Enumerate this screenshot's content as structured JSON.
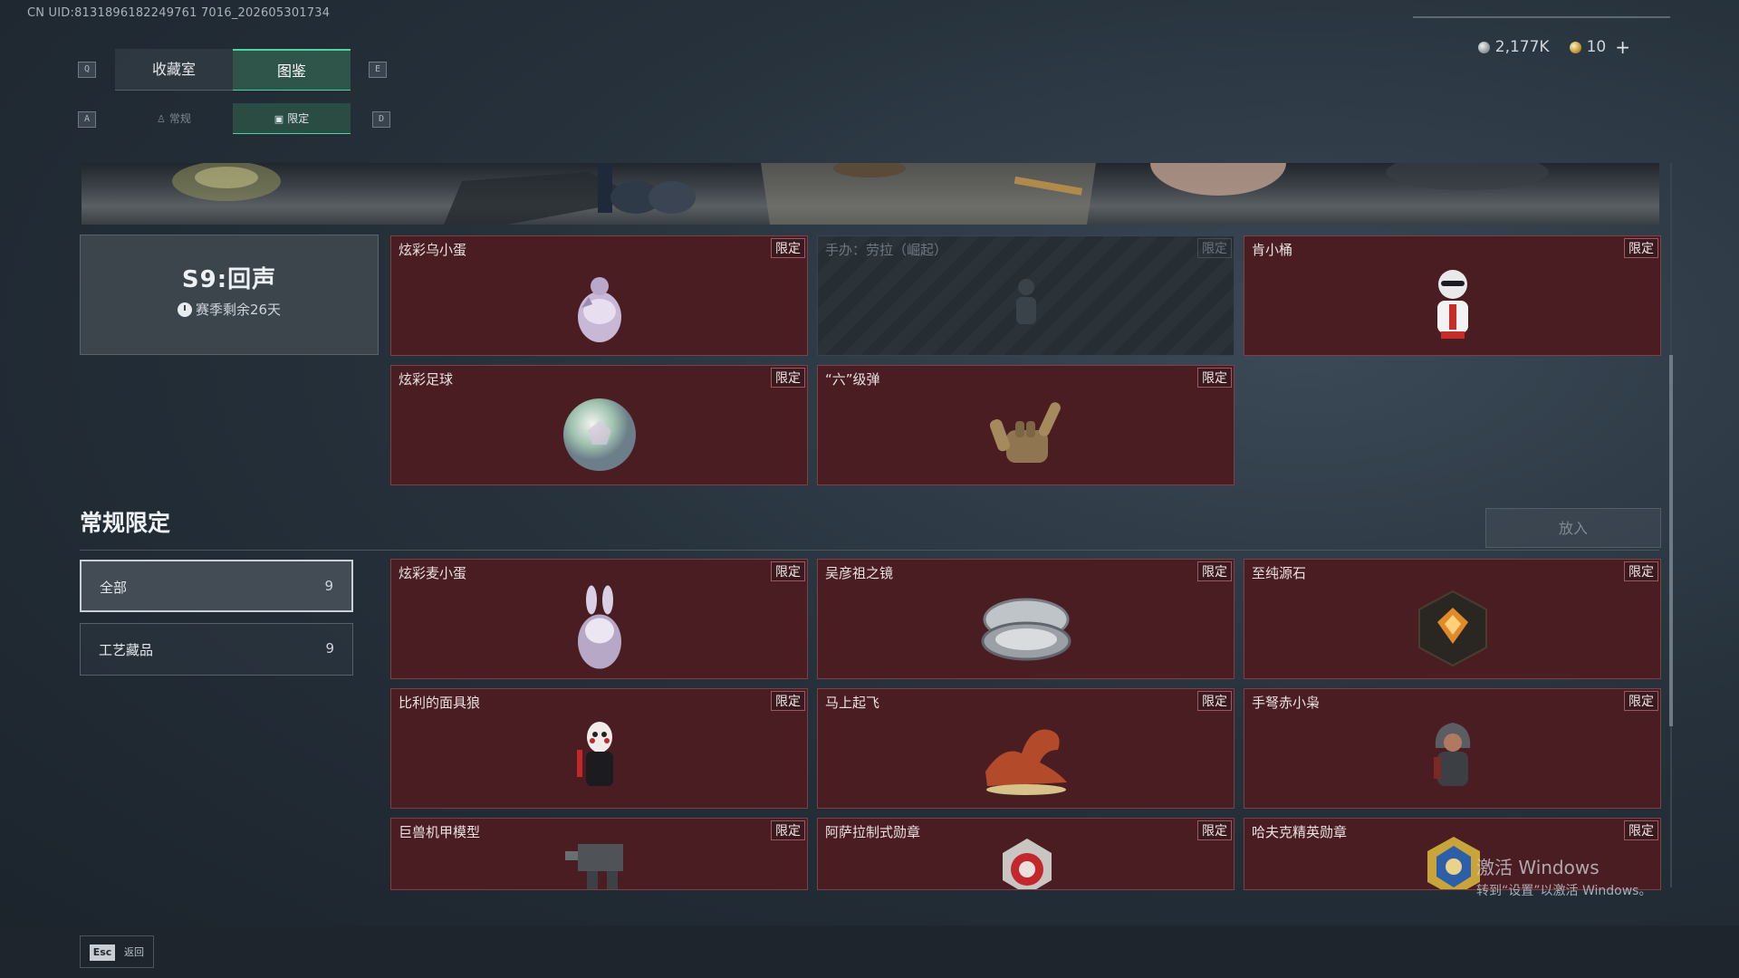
{
  "uid": "CN UID:8131896182249761 7016_202605301734",
  "currency": {
    "silver": "2,177K",
    "gold": "10",
    "plus": "+"
  },
  "keys": {
    "q": "Q",
    "e": "E",
    "a": "A",
    "d": "D"
  },
  "tabs": [
    {
      "label": "收藏室"
    },
    {
      "label": "图鉴"
    }
  ],
  "subtabs": [
    {
      "label": "常规"
    },
    {
      "label": "限定"
    }
  ],
  "season": {
    "title": "S9:回声",
    "remaining": "赛季剩余26天"
  },
  "featured": [
    {
      "name": "炫彩乌小蛋",
      "tag": "限定",
      "locked": false,
      "icon": "egg-crow-icon"
    },
    {
      "name": "手办：劳拉（崛起）",
      "tag": "限定",
      "locked": true,
      "icon": "figure-lara-icon"
    },
    {
      "name": "肯小桶",
      "tag": "限定",
      "locked": false,
      "icon": "figure-colonel-icon"
    },
    {
      "name": "炫彩足球",
      "tag": "限定",
      "locked": false,
      "icon": "football-icon"
    },
    {
      "name": "“六”级弹",
      "tag": "限定",
      "locked": false,
      "icon": "hand-gesture-icon"
    }
  ],
  "section": {
    "title": "常规限定",
    "put_button": "放入"
  },
  "filters": [
    {
      "label": "全部",
      "count": "9"
    },
    {
      "label": "工艺藏品",
      "count": "9"
    }
  ],
  "items": [
    {
      "name": "炫彩麦小蛋",
      "tag": "限定",
      "icon": "egg-rabbit-icon"
    },
    {
      "name": "吴彦祖之镜",
      "tag": "限定",
      "icon": "compact-mirror-icon"
    },
    {
      "name": "至纯源石",
      "tag": "限定",
      "icon": "source-stone-icon"
    },
    {
      "name": "比利的面具狼",
      "tag": "限定",
      "icon": "billy-puppet-icon"
    },
    {
      "name": "马上起飞",
      "tag": "限定",
      "icon": "horse-sculpture-icon"
    },
    {
      "name": "手弩赤小枭",
      "tag": "限定",
      "icon": "hooded-figure-icon"
    },
    {
      "name": "巨兽机甲模型",
      "tag": "限定",
      "icon": "mech-model-icon"
    },
    {
      "name": "阿萨拉制式勋章",
      "tag": "限定",
      "icon": "asala-medal-icon"
    },
    {
      "name": "哈夫克精英勋章",
      "tag": "限定",
      "icon": "haavk-medal-icon"
    }
  ],
  "footer": {
    "esc_key": "Esc",
    "back": "返回"
  },
  "watermark": {
    "line1": "激活 Windows",
    "line2": "转到“设置”以激活 Windows。"
  },
  "colors": {
    "accent": "#4ed3a0",
    "card_bg": "#4a1d22",
    "card_border": "#7c4048"
  }
}
